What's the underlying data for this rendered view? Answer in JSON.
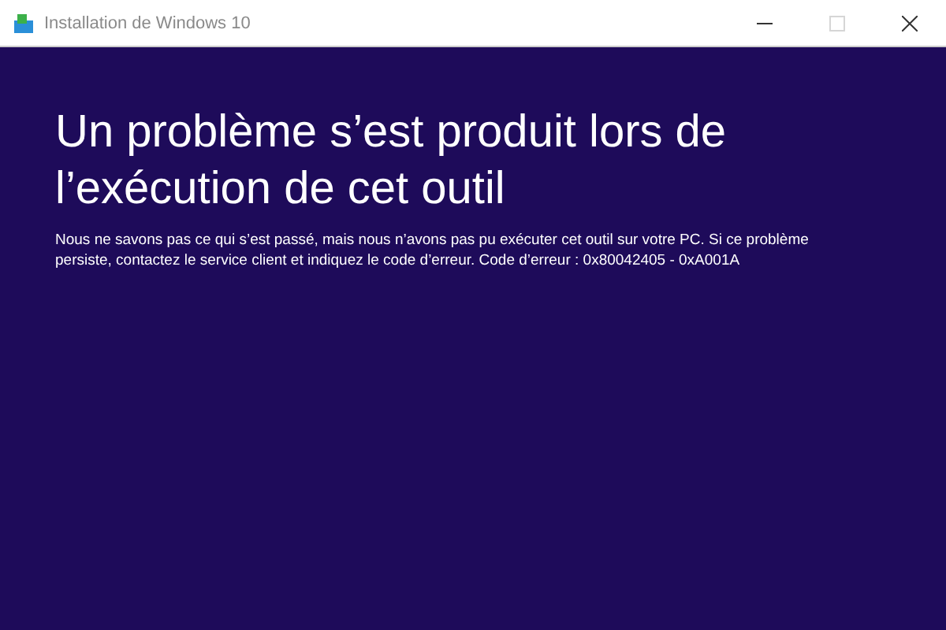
{
  "window": {
    "title": "Installation de Windows 10",
    "controls": [
      {
        "kind": "minimize",
        "disabled": false
      },
      {
        "kind": "maximize",
        "disabled": true
      },
      {
        "kind": "close",
        "disabled": false
      }
    ]
  },
  "error": {
    "heading": "Un problème s’est produit lors de l’exécution de cet outil",
    "message": "Nous ne savons pas ce qui s’est passé, mais nous n’avons pas pu exécuter cet outil sur votre PC. Si ce problème persiste, contactez le service client et indiquez le code d’erreur. Code d’erreur : 0x80042405 - 0xA001A"
  }
}
